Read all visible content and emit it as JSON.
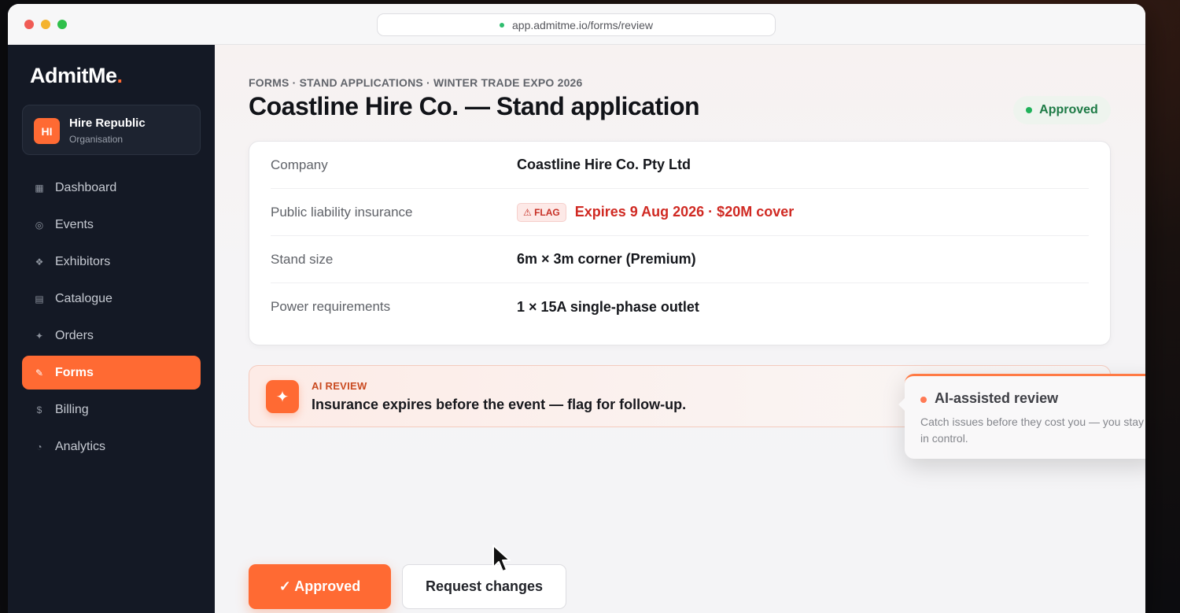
{
  "browser": {
    "url": "app.admitme.io/forms/review"
  },
  "sidebar": {
    "logo_main": "AdmitMe",
    "logo_accent": ".",
    "org": {
      "initials": "HI",
      "name": "Hire Republic",
      "type": "Organisation"
    },
    "items": [
      {
        "label": "Dashboard",
        "icon": "grid-icon"
      },
      {
        "label": "Events",
        "icon": "circle-icon"
      },
      {
        "label": "Exhibitors",
        "icon": "diamond-icon"
      },
      {
        "label": "Catalogue",
        "icon": "list-icon"
      },
      {
        "label": "Orders",
        "icon": "sparkle-icon"
      },
      {
        "label": "Forms",
        "icon": "pencil-icon",
        "active": true
      },
      {
        "label": "Billing",
        "icon": "dollar-icon"
      },
      {
        "label": "Analytics",
        "icon": "pie-chart-icon"
      }
    ]
  },
  "header": {
    "breadcrumb": "FORMS · STAND APPLICATIONS · WINTER TRADE EXPO 2026",
    "title": "Coastline Hire Co. — Stand application",
    "status": "Approved",
    "status_color": "#1fb25a"
  },
  "details": [
    {
      "label": "Company",
      "value": "Coastline Hire Co. Pty Ltd"
    },
    {
      "label": "Public liability insurance",
      "flag": "⚠ FLAG",
      "value": "Expires 9 Aug 2026 · $20M cover"
    },
    {
      "label": "Stand size",
      "value": "6m × 3m corner (Premium)"
    },
    {
      "label": "Power requirements",
      "value": "1 × 15A single-phase outlet"
    }
  ],
  "ai_review": {
    "label": "AI REVIEW",
    "message": "Insurance expires before the event — flag for follow-up."
  },
  "tooltip": {
    "title": "AI-assisted review",
    "body": "Catch issues before they cost you — you stay in control."
  },
  "actions": {
    "approve_label": "✓ Approved",
    "request_label": "Request changes"
  },
  "colors": {
    "accent": "#ff6a33",
    "sidebar_bg": "#141925",
    "flag_red": "#d02a23"
  }
}
